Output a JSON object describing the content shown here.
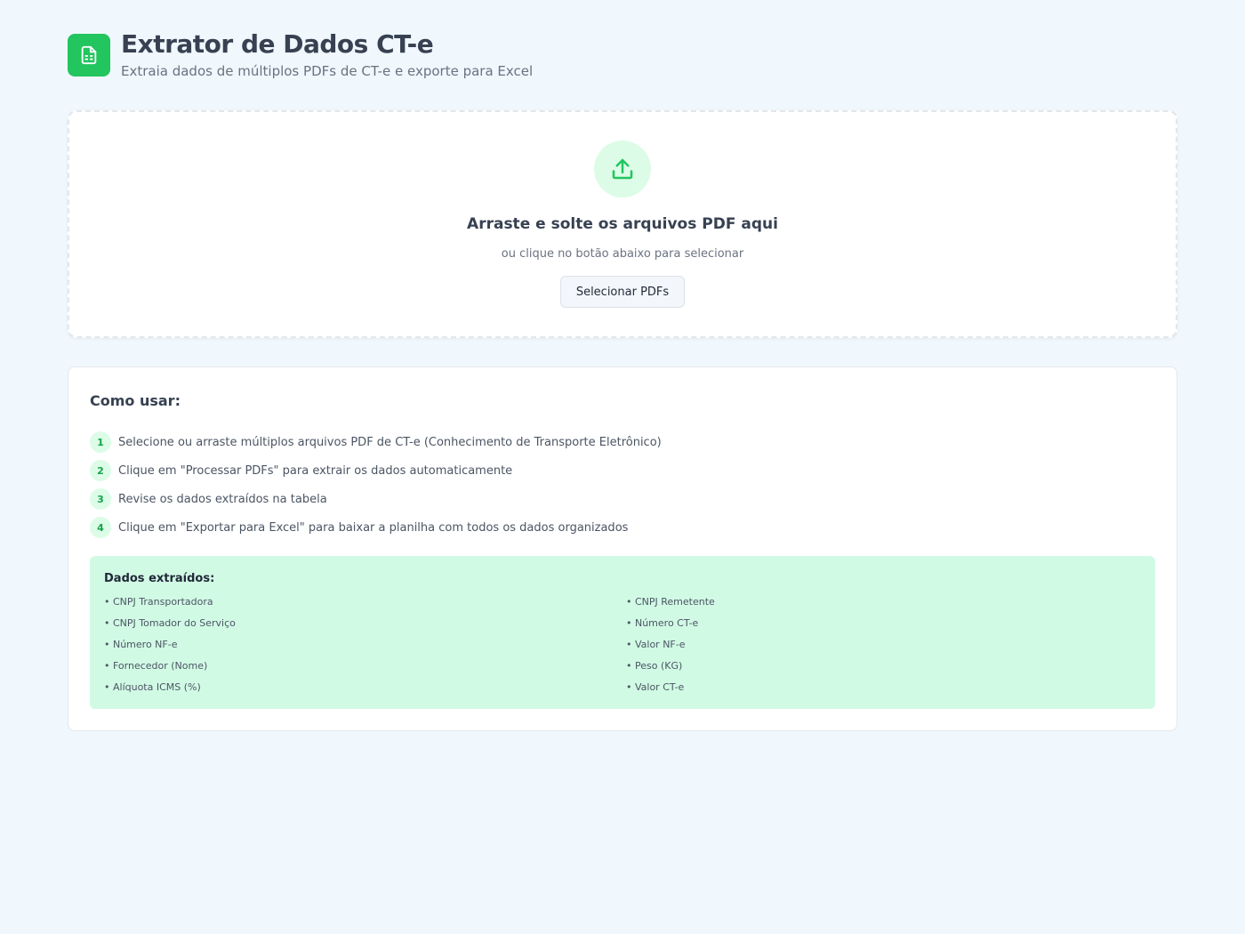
{
  "header": {
    "title": "Extrator de Dados CT-e",
    "subtitle": "Extraia dados de múltiplos PDFs de CT-e e exporte para Excel",
    "logo_icon": "file-spreadsheet-icon",
    "accent_color": "#22c55e"
  },
  "upload": {
    "icon": "upload-icon",
    "title": "Arraste e solte os arquivos PDF aqui",
    "hint": "ou clique no botão abaixo para selecionar",
    "button_label": "Selecionar PDFs"
  },
  "instructions": {
    "title": "Como usar:",
    "steps": [
      {
        "num": "1",
        "text": "Selecione ou arraste múltiplos arquivos PDF de CT-e (Conhecimento de Transporte Eletrônico)"
      },
      {
        "num": "2",
        "text": "Clique em \"Processar PDFs\" para extrair os dados automaticamente"
      },
      {
        "num": "3",
        "text": "Revise os dados extraídos na tabela"
      },
      {
        "num": "4",
        "text": "Clique em \"Exportar para Excel\" para baixar a planilha com todos os dados organizados"
      }
    ],
    "fields_title": "Dados extraídos:",
    "fields_left": [
      "• CNPJ Transportadora",
      "• CNPJ Tomador do Serviço",
      "• Número NF-e",
      "• Fornecedor (Nome)",
      "• Alíquota ICMS (%)"
    ],
    "fields_right": [
      "• CNPJ Remetente",
      "• Número CT-e",
      "• Valor NF-e",
      "• Peso (KG)",
      "• Valor CT-e"
    ]
  }
}
